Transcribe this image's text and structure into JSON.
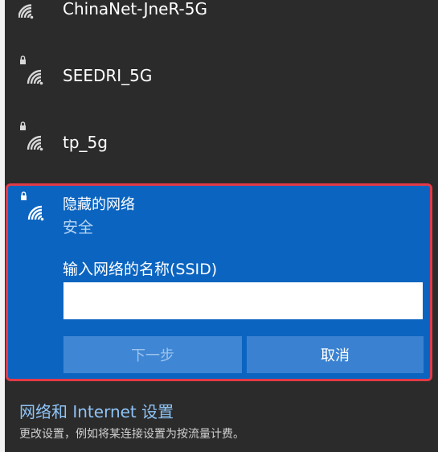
{
  "networks": [
    {
      "name": "ChinaNet-JneR-5G",
      "icon": "wifi-signal-icon",
      "secured": false
    },
    {
      "name": "SEEDRI_5G",
      "icon": "wifi-secured-icon",
      "secured": true
    },
    {
      "name": "tp_5g",
      "icon": "wifi-secured-icon",
      "secured": true
    }
  ],
  "hidden_network": {
    "title": "隐藏的网络",
    "security": "安全",
    "ssid_label": "输入网络的名称(SSID)",
    "ssid_value": "",
    "next_label": "下一步",
    "cancel_label": "取消",
    "highlight_color": "#e23a48",
    "accent_color": "#0b64c0"
  },
  "settings": {
    "link": "网络和 Internet 设置",
    "description": "更改设置，例如将某连接设置为按流量计费。"
  }
}
